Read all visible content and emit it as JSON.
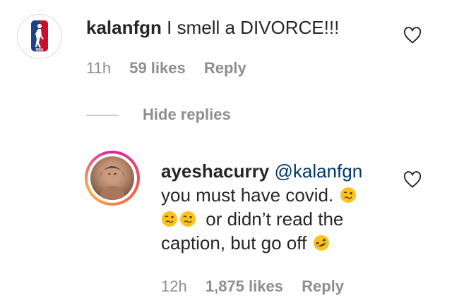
{
  "comment": {
    "username": "kalanfgn",
    "text": "I smell a DIVORCE!!!",
    "time": "11h",
    "likes": "59 likes",
    "reply_label": "Reply",
    "avatar_icon": "nba-logo-icon",
    "avatar_badge_text": "NBA"
  },
  "replies_toggle": {
    "label": "Hide replies"
  },
  "reply": {
    "username": "ayeshacurry",
    "mention": "@kalanfgn",
    "line1": "you must have covid.",
    "line2": "or didn’t read the",
    "line3": "caption, but go off",
    "emoji_woozy": "woozy-face-icon",
    "emoji_rofl": "rolling-on-floor-laughing-icon",
    "time": "12h",
    "likes": "1,875 likes",
    "reply_label": "Reply"
  },
  "colors": {
    "text": "#262626",
    "meta": "#8e8e8e",
    "mention": "#00376b",
    "nba_blue": "#1d428a",
    "nba_red": "#c8102e"
  }
}
